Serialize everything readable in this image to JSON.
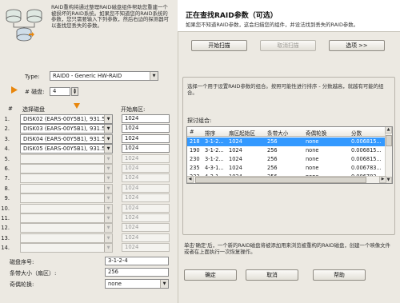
{
  "intro_text": "RAID重构将通过整理RAID磁盘组件帮助您重建一个被损坏的RAID系统。如果您不知道您的RAID系统的参数，您只需要输入下列参数，然后右边的探测器可以查找您丢失的参数。",
  "type_label": "Type:",
  "type_value": "RAID0 - Generic HW-RAID",
  "disk_count_label": "# 磁盘:",
  "disk_count_value": "4",
  "col_num": "#",
  "col_disk": "选择磁盘",
  "col_start": "开始扇区:",
  "disks": [
    {
      "num": "1.",
      "disk": "DISK02 (EARS-00Y5B1), 931.51G",
      "start": "1024"
    },
    {
      "num": "2.",
      "disk": "DISK03 (EARS-00Y5B1), 931.51G",
      "start": "1024"
    },
    {
      "num": "3.",
      "disk": "DISK04 (EARS-00Y5B1), 931.51G",
      "start": "1024"
    },
    {
      "num": "4.",
      "disk": "DISK05 (EARS-00Y5B1), 931.51G",
      "start": "1024"
    },
    {
      "num": "5.",
      "disk": "",
      "start": "1024"
    },
    {
      "num": "6.",
      "disk": "",
      "start": "1024"
    },
    {
      "num": "7.",
      "disk": "",
      "start": "1024"
    },
    {
      "num": "8.",
      "disk": "",
      "start": "1024"
    },
    {
      "num": "9.",
      "disk": "",
      "start": "1024"
    },
    {
      "num": "10.",
      "disk": "",
      "start": "1024"
    },
    {
      "num": "11.",
      "disk": "",
      "start": "1024"
    },
    {
      "num": "12.",
      "disk": "",
      "start": "1024"
    },
    {
      "num": "13.",
      "disk": "",
      "start": "1024"
    },
    {
      "num": "14.",
      "disk": "",
      "start": "1024"
    }
  ],
  "order_label": "磁盘序号:",
  "order_value": "3-1-2-4",
  "stripe_label": "条带大小（扇区）:",
  "stripe_value": "256",
  "parity_label": "奇偶轮换:",
  "parity_value": "none",
  "right_title": "正在查找RAID参数（可选）",
  "right_hint": "如果您不知道RAID参数，这会扫描您的组件，并设法找到丢失的RAID参数。",
  "btn_start": "开始扫描",
  "btn_cancel_scan": "取消扫描",
  "btn_options": "选项 >>",
  "select_hint": "选择一个用于设置RAID参数的组合。按照可能性进行排序 - 分数越高，就越有可能的组合。",
  "combos_label": "探讨组合:",
  "table_headers": [
    "#",
    "排序",
    "扇区起始区",
    "条带大小",
    "奇偶轮换",
    "分数"
  ],
  "table_rows": [
    [
      "218",
      "3-1-2...",
      "1024",
      "256",
      "none",
      "0.006815..."
    ],
    [
      "190",
      "3-1-2...",
      "1024",
      "256",
      "none",
      "0.006815..."
    ],
    [
      "230",
      "3-1-2...",
      "1024",
      "256",
      "none",
      "0.006815..."
    ],
    [
      "235",
      "4-3-1...",
      "1024",
      "256",
      "none",
      "0.006783..."
    ],
    [
      "233",
      "4-3-1...",
      "1024",
      "256",
      "none",
      "0.006783..."
    ],
    [
      "226",
      "3-2-4...",
      "1024",
      "256",
      "none",
      "0.006758..."
    ]
  ],
  "confirm_hint": "单击'确定'后，一个新的RAID磁盘将被添加用来浏览被重构的RAID磁盘，创建一个映像文件或者在上面执行一次恢复操作。",
  "btn_ok": "确定",
  "btn_cancel": "取消",
  "btn_help": "帮助",
  "colors": {
    "selection": "#3399ff",
    "accent_arrow": "#e8860c"
  }
}
